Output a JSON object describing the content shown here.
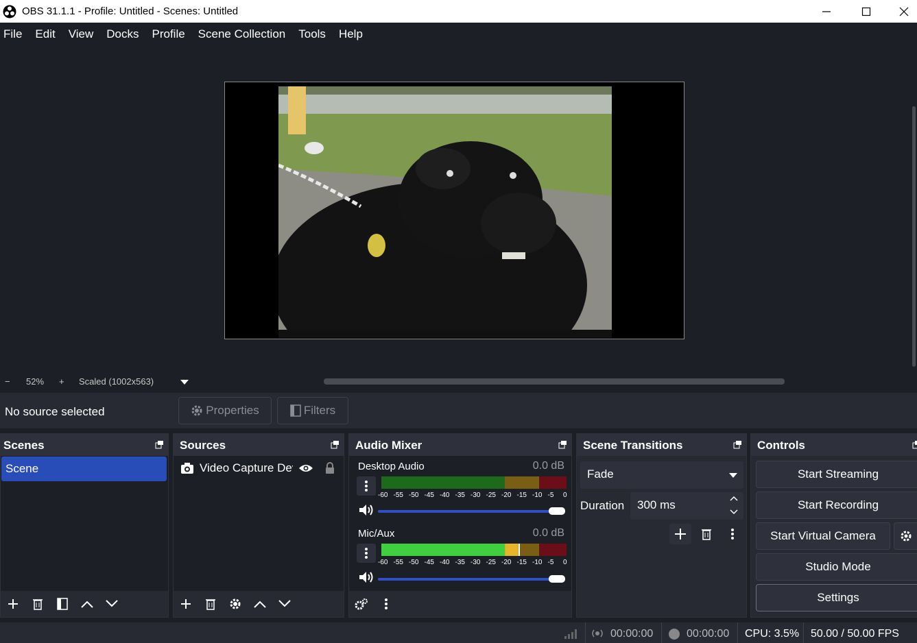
{
  "window": {
    "title": "OBS 31.1.1 - Profile: Untitled - Scenes: Untitled"
  },
  "menu": [
    "File",
    "Edit",
    "View",
    "Docks",
    "Profile",
    "Scene Collection",
    "Tools",
    "Help"
  ],
  "zoom": {
    "minus": "−",
    "value": "52%",
    "plus": "+",
    "mode": "Scaled (1002x563)"
  },
  "source_toolbar": {
    "status": "No source selected",
    "properties": "Properties",
    "filters": "Filters"
  },
  "scenes": {
    "title": "Scenes",
    "items": [
      "Scene"
    ]
  },
  "sources": {
    "title": "Sources",
    "items": [
      "Video Capture Dev"
    ]
  },
  "mixer": {
    "title": "Audio Mixer",
    "channels": [
      {
        "name": "Desktop Audio",
        "db": "0.0 dB",
        "level": 0
      },
      {
        "name": "Mic/Aux",
        "db": "0.0 dB",
        "level": 0.74
      }
    ],
    "scale": [
      "-60",
      "-55",
      "-50",
      "-45",
      "-40",
      "-35",
      "-30",
      "-25",
      "-20",
      "-15",
      "-10",
      "-5",
      "0"
    ]
  },
  "transitions": {
    "title": "Scene Transitions",
    "selected": "Fade",
    "duration_label": "Duration",
    "duration": "300 ms"
  },
  "controls": {
    "title": "Controls",
    "start_streaming": "Start Streaming",
    "start_recording": "Start Recording",
    "start_virtual_camera": "Start Virtual Camera",
    "studio_mode": "Studio Mode",
    "settings": "Settings"
  },
  "status": {
    "stream_time": "00:00:00",
    "rec_time": "00:00:00",
    "cpu": "CPU: 3.5%",
    "fps": "50.00 / 50.00 FPS"
  },
  "colors": {
    "accent": "#284cb8",
    "meter_green": "#3fcf3f",
    "meter_yellow": "#e5b52a",
    "meter_red": "#c8192c"
  }
}
